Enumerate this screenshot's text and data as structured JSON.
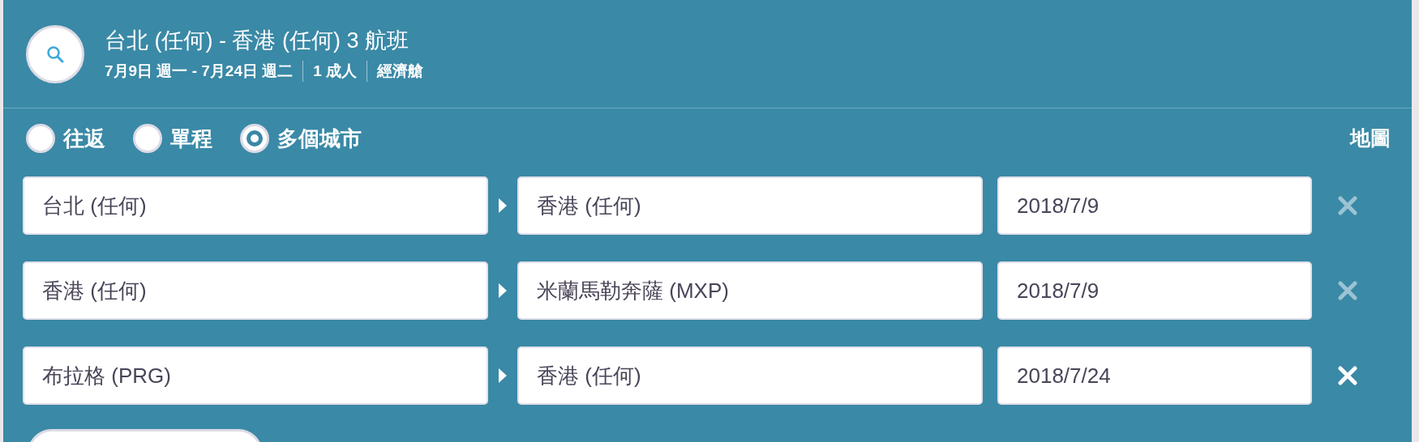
{
  "header": {
    "title": "台北 (任何) - 香港 (任何) 3 航班",
    "details": [
      "7月9日 週一 - 7月24日 週二",
      "1 成人",
      "經濟艙"
    ]
  },
  "trip_types": [
    {
      "label": "往返",
      "selected": false
    },
    {
      "label": "單程",
      "selected": false
    },
    {
      "label": "多個城市",
      "selected": true
    }
  ],
  "map_link": "地圖",
  "legs": [
    {
      "from": "台北 (任何)",
      "to": "香港 (任何)",
      "date": "2018/7/9",
      "removable": false
    },
    {
      "from": "香港 (任何)",
      "to": "米蘭馬勒奔薩 (MXP)",
      "date": "2018/7/9",
      "removable": false
    },
    {
      "from": "布拉格 (PRG)",
      "to": "香港 (任何)",
      "date": "2018/7/24",
      "removable": true
    }
  ]
}
